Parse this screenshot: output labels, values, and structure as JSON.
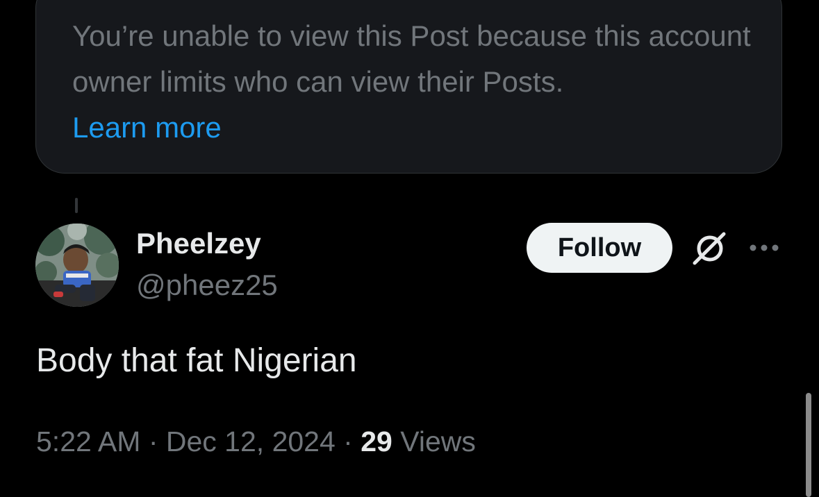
{
  "notice": {
    "text": "You’re unable to view this Post because this account owner limits who can view their Posts.",
    "link": "Learn more"
  },
  "author": {
    "display_name": "Pheelzey",
    "handle": "@pheez25",
    "avatar_icon": "cartoon-avatar"
  },
  "actions": {
    "follow_label": "Follow",
    "grok_icon": "grok-icon",
    "more_icon": "more-options-icon"
  },
  "post": {
    "text": "Body that fat Nigerian",
    "time": "5:22 AM",
    "separator": " · ",
    "date": "Dec 12, 2024",
    "views_count": "29",
    "views_label": "Views"
  },
  "colors": {
    "background": "#000000",
    "card": "#16181c",
    "link": "#1d9bf0",
    "muted": "#71767b",
    "primary_text": "#e7e9ea"
  }
}
